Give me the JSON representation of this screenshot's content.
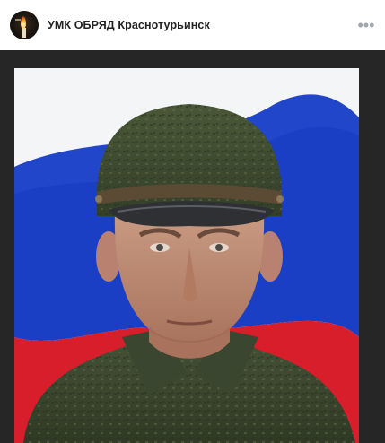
{
  "post": {
    "author_name": "УМК ОБРЯД Краснотурьинск",
    "avatar_icon": "memorial-candle-avatar",
    "more_icon": "more-dots-icon",
    "more_glyph": "•••",
    "photo": {
      "description_icon": "portrait-photo",
      "colors": {
        "flag_white": "#f4f5f7",
        "flag_blue": "#1b3fc4",
        "flag_red": "#d81e2a",
        "uniform": "#3d4a30",
        "frame": "#262626"
      }
    }
  }
}
